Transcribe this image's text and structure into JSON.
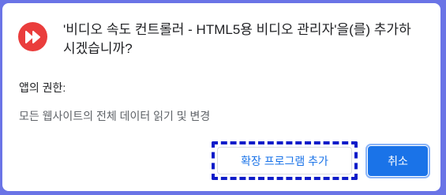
{
  "dialog": {
    "title": "'비디오 속도 컨트롤러 - HTML5용 비디오 관리자'을(를) 추가하시겠습니까?",
    "icon": "fast-forward-icon",
    "permissions_heading": "앱의 권한:",
    "permissions": [
      "모든 웹사이트의 전체 데이터 읽기 및 변경"
    ],
    "buttons": {
      "add": "확장 프로그램 추가",
      "cancel": "취소"
    }
  },
  "colors": {
    "background": "#6a74e6",
    "icon_bg": "#ea3d3c",
    "primary": "#1a73e8",
    "highlight_dash": "#0f1cc9"
  }
}
